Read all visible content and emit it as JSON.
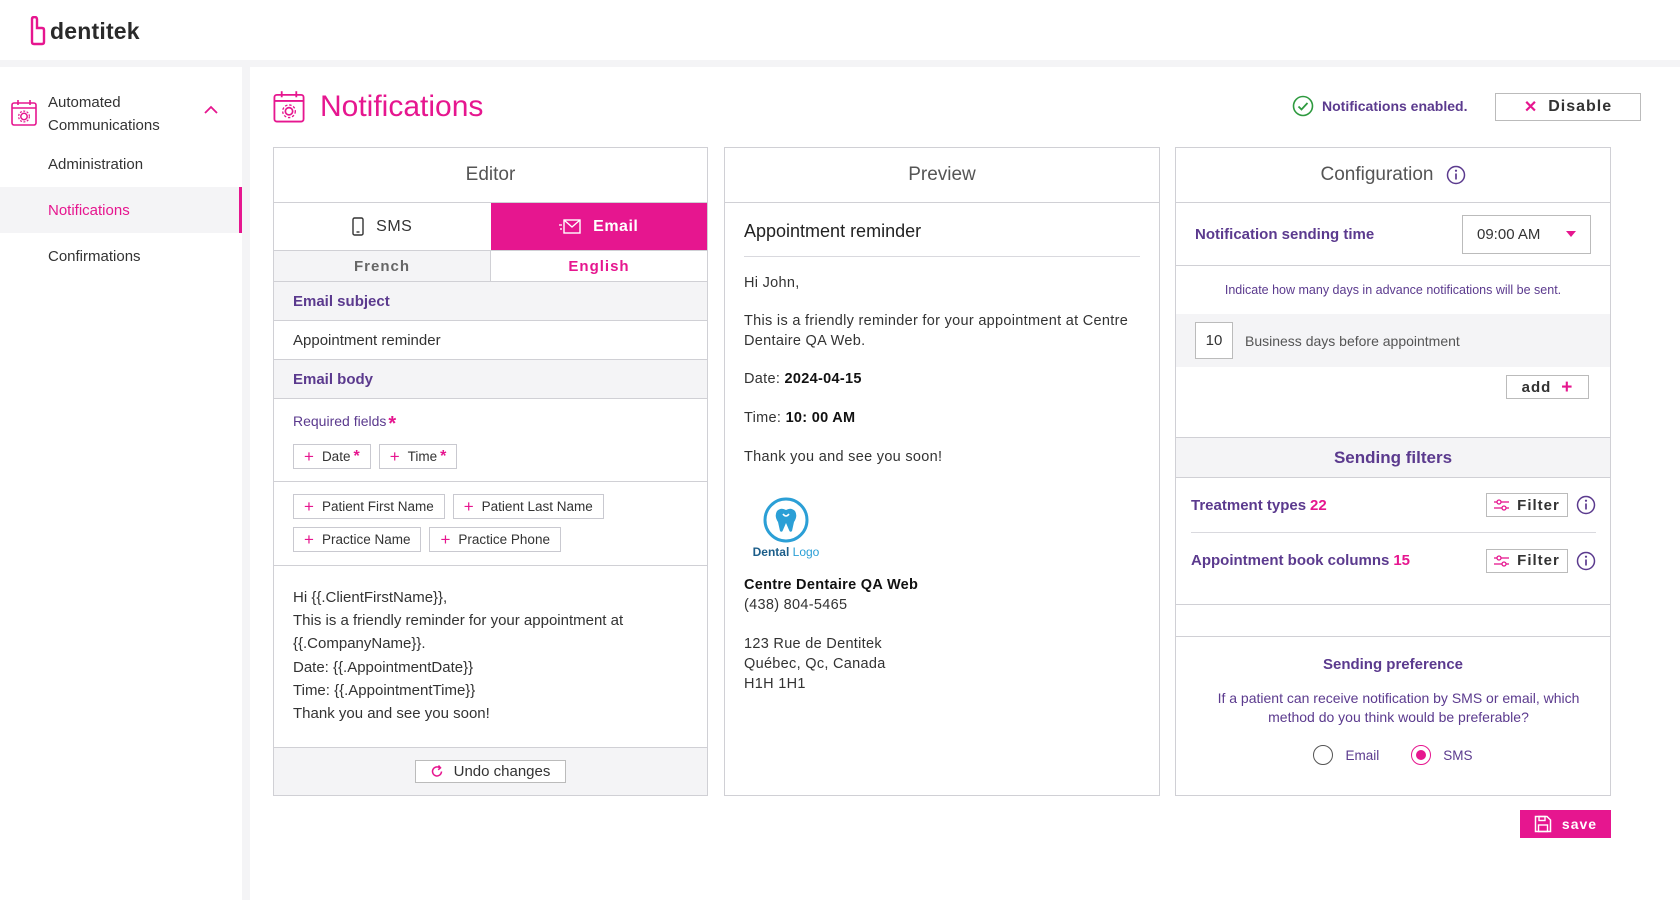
{
  "app": {
    "logo_text": "dentitek"
  },
  "sidebar": {
    "group": {
      "label": "Automated Communications",
      "icon": "calendar-gear-icon"
    },
    "items": [
      {
        "label": "Administration",
        "active": false
      },
      {
        "label": "Notifications",
        "active": true
      },
      {
        "label": "Confirmations",
        "active": false
      }
    ]
  },
  "page": {
    "title": "Notifications",
    "status_text": "Notifications enabled.",
    "disable_label": "Disable"
  },
  "editor": {
    "header": "Editor",
    "tabs": [
      {
        "label": "SMS",
        "selected": false,
        "icon": "phone-icon"
      },
      {
        "label": "Email",
        "selected": true,
        "icon": "email-icon"
      }
    ],
    "languages": [
      {
        "label": "French",
        "selected": false
      },
      {
        "label": "English",
        "selected": true
      }
    ],
    "subject_label": "Email subject",
    "subject_value": "Appointment reminder",
    "body_label": "Email body",
    "required_title": "Required fields",
    "required_chips": [
      "Date",
      "Time"
    ],
    "optional_chips": [
      "Patient First Name",
      "Patient Last Name",
      "Practice Name",
      "Practice Phone"
    ],
    "body_lines": [
      "Hi {{.ClientFirstName}},",
      "This is a friendly reminder for your appointment at",
      "{{.CompanyName}}.",
      "Date: {{.AppointmentDate}}",
      "Time: {{.AppointmentTime}}",
      "Thank you and see you soon!"
    ],
    "undo_label": "Undo changes"
  },
  "preview": {
    "header": "Preview",
    "title": "Appointment reminder",
    "greeting": "Hi John,",
    "intro": "This is a friendly reminder for your appointment at Centre Dentaire QA Web.",
    "date_label": "Date:",
    "date_value": "2024-04-15",
    "time_label": "Time:",
    "time_value": "10: 00 AM",
    "closing": "Thank you and see you soon!",
    "logo_word1": "Dental",
    "logo_word2": "Logo",
    "company": "Centre Dentaire QA Web",
    "phone": "(438) 804-5465",
    "address_lines": [
      "123 Rue de Dentitek",
      "Québec, Qc, Canada",
      "H1H 1H1"
    ]
  },
  "config": {
    "header": "Configuration",
    "sending_time_label": "Notification sending time",
    "sending_time_value": "09:00 AM",
    "hint": "Indicate how many days in advance notifications will be sent.",
    "days_value": "10",
    "days_label": "Business days before appointment",
    "add_label": "add",
    "filters_header": "Sending filters",
    "filters": [
      {
        "label": "Treatment types",
        "count": "22",
        "button": "Filter"
      },
      {
        "label": "Appointment book columns",
        "count": "15",
        "button": "Filter"
      }
    ],
    "preference_title": "Sending preference",
    "preference_question": "If a patient can receive notification by SMS or email, which method do you think would be preferable?",
    "preference_options": [
      {
        "label": "Email",
        "selected": false
      },
      {
        "label": "SMS",
        "selected": true
      }
    ]
  },
  "save_label": "save",
  "colors": {
    "accent": "#e6168f",
    "purple": "#5b3a8e",
    "border": "#d0d0d5",
    "success": "#2e9a3f"
  }
}
